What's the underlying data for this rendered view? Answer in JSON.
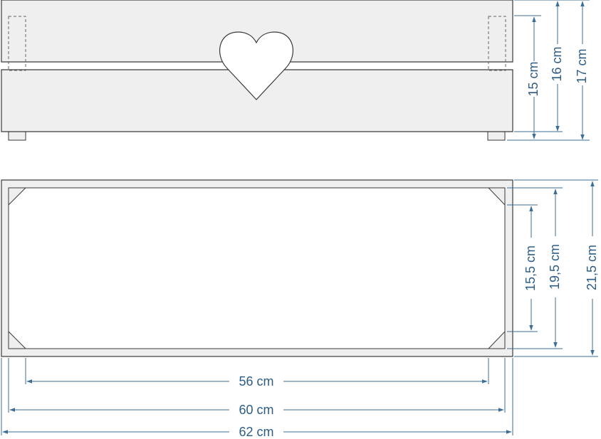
{
  "colors": {
    "board_fill": "#efefef",
    "board_stroke": "#3a3a3a",
    "dimension": "#3d6e96",
    "dimension_text": "#2d5d86",
    "hidden_line": "#666666"
  },
  "side_view": {
    "heart_cutout": "heart-shape",
    "dimensions": {
      "height_15": "15 cm",
      "height_16": "16 cm",
      "height_17": "17 cm"
    }
  },
  "top_view": {
    "dimensions": {
      "depth_15_5": "15,5 cm",
      "depth_19_5": "19,5 cm",
      "depth_21_5": "21,5 cm",
      "length_56": "56 cm",
      "length_60": "60 cm",
      "length_62": "62 cm"
    }
  }
}
